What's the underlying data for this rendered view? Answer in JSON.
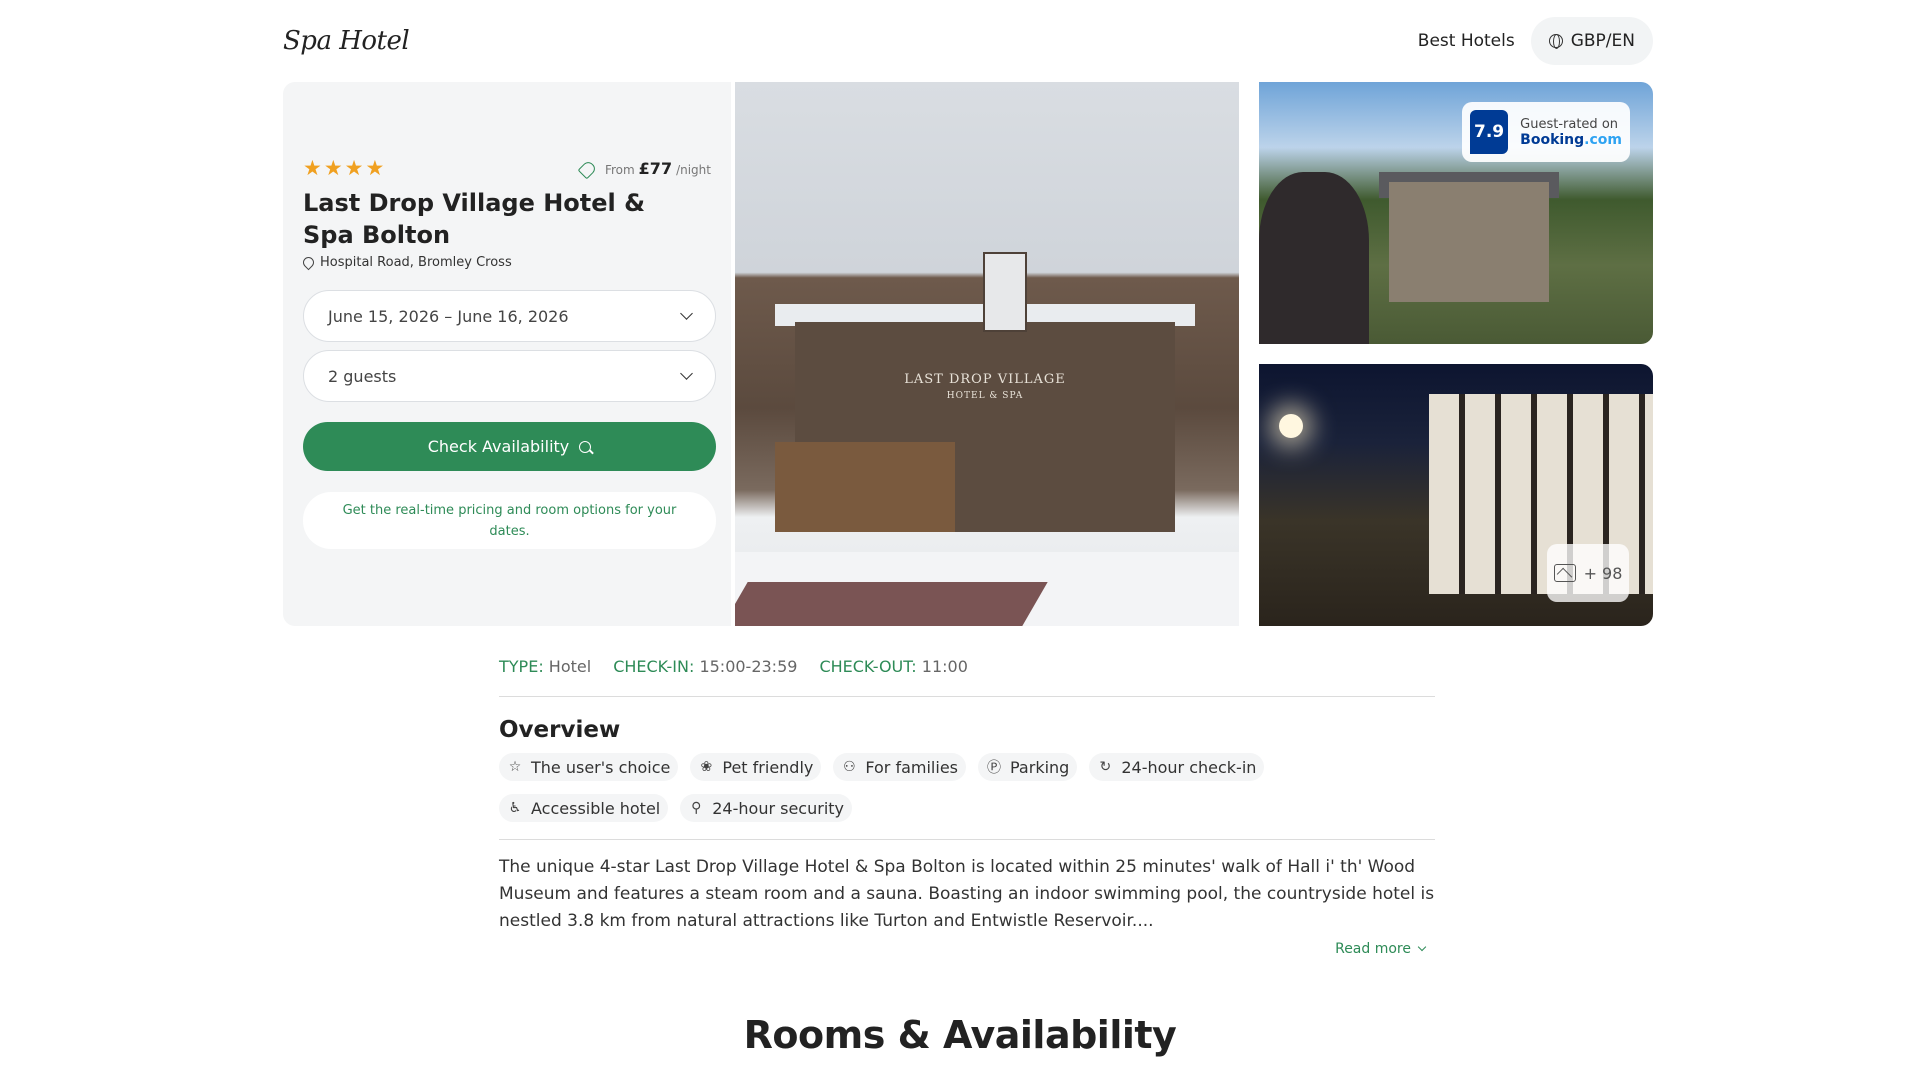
{
  "header": {
    "logo": "Spa Hotel",
    "nav_link": "Best Hotels",
    "currency": "GBP/EN"
  },
  "hotel": {
    "stars": 4,
    "price_prefix": "From",
    "price": "£77",
    "price_suffix": "/night",
    "name": "Last Drop Village Hotel & Spa Bolton",
    "address": "Hospital Road, Bromley Cross",
    "dates": "June 15, 2026 – June 16, 2026",
    "guests": "2 guests",
    "check_button": "Check Availability",
    "hint": "Get the real-time pricing and room options for your dates."
  },
  "photos": {
    "main_sign": "LAST DROP VILLAGE",
    "main_sign_sub": "HOTEL & SPA",
    "rating_score": "7.9",
    "rating_label": "Guest-rated on",
    "rating_brand_main": "Booking",
    "rating_brand_suffix": ".com",
    "more_count": "+ 98"
  },
  "facts": [
    {
      "key": "TYPE",
      "value": "Hotel"
    },
    {
      "key": "CHECK-IN",
      "value": "15:00-23:59"
    },
    {
      "key": "CHECK-OUT",
      "value": "11:00"
    }
  ],
  "overview": {
    "title": "Overview",
    "chips": [
      {
        "label": "The user's choice",
        "icon": "star-icon"
      },
      {
        "label": "Pet friendly",
        "icon": "paw-icon"
      },
      {
        "label": "For families",
        "icon": "family-icon"
      },
      {
        "label": "Parking",
        "icon": "parking-icon"
      },
      {
        "label": "24-hour check-in",
        "icon": "clock-rotate-icon"
      },
      {
        "label": "Accessible hotel",
        "icon": "wheelchair-icon"
      },
      {
        "label": "24-hour security",
        "icon": "security-person-icon"
      }
    ],
    "description": "The unique 4-star Last Drop Village Hotel & Spa Bolton is located within 25 minutes' walk of Hall i' th' Wood Museum and features a steam room and a sauna. Boasting an indoor swimming pool, the countryside hotel is nestled 3.8 km from natural attractions like Turton and Entwistle Reservoir....",
    "read_more": "Read more"
  },
  "rooms": {
    "title": "Rooms & Availability"
  },
  "colors": {
    "accent": "#2e8b57",
    "star": "#f0a020",
    "booking_blue": "#003b95"
  }
}
